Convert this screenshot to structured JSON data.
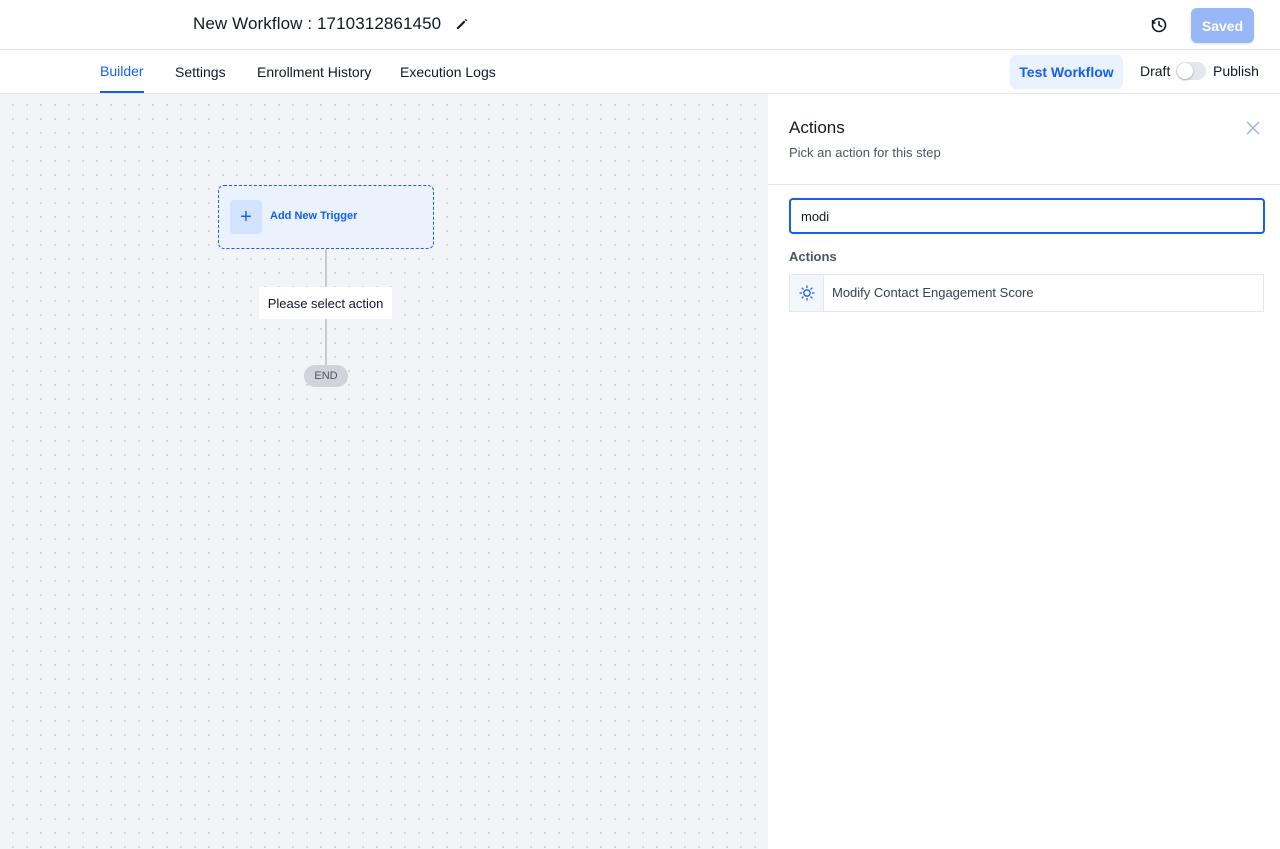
{
  "header": {
    "title": "New Workflow : 1710312861450",
    "saved_label": "Saved",
    "colors": {
      "accent": "#155eef",
      "saved_button": "#97b7f7"
    }
  },
  "tabs": {
    "items": [
      {
        "label": "Builder",
        "active": true
      },
      {
        "label": "Settings",
        "active": false
      },
      {
        "label": "Enrollment History",
        "active": false
      },
      {
        "label": "Execution Logs",
        "active": false
      }
    ],
    "test_workflow_label": "Test Workflow",
    "draft_label": "Draft",
    "publish_label": "Publish",
    "publish_toggle_on": false
  },
  "canvas": {
    "trigger_label": "Add New Trigger",
    "action_placeholder": "Please select action",
    "end_label": "END"
  },
  "panel": {
    "title": "Actions",
    "subtitle": "Pick an action for this step",
    "search_value": "modi",
    "section_label": "Actions",
    "results": [
      {
        "label": "Modify Contact Engagement Score",
        "icon": "engagement-score-icon"
      }
    ]
  }
}
